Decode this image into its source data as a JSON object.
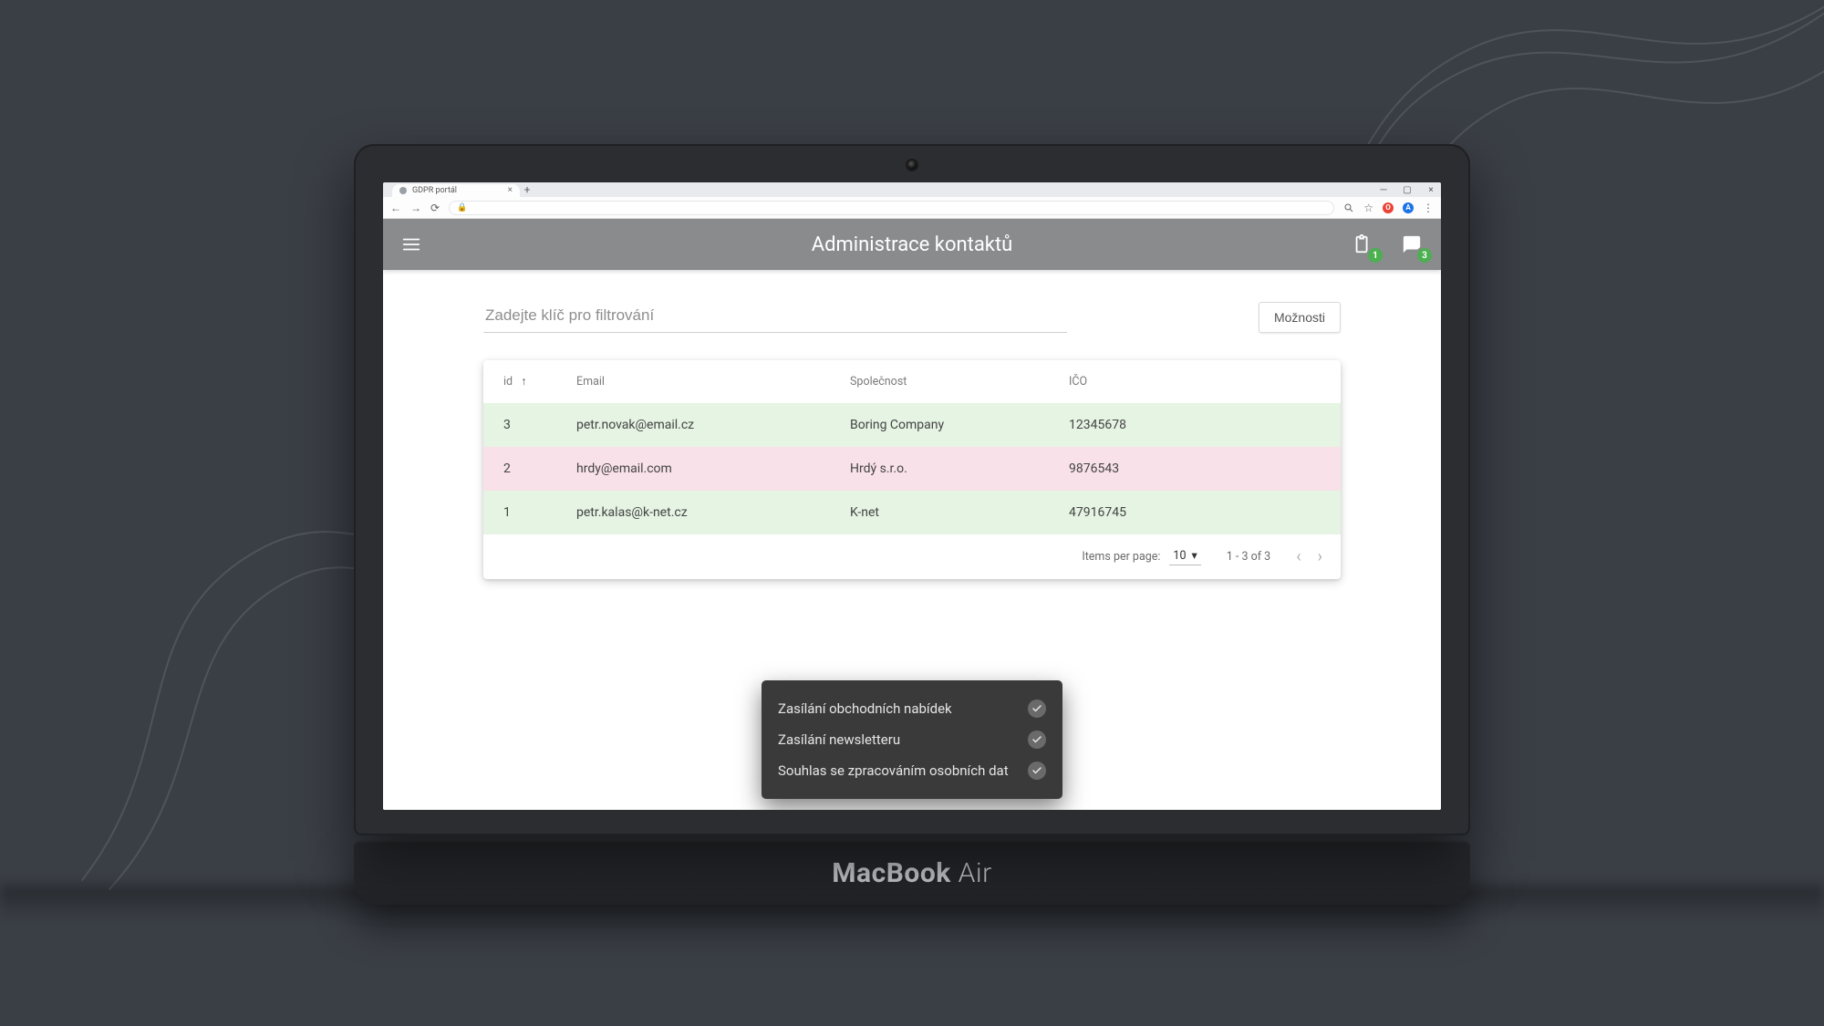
{
  "browser": {
    "tab_title": "GDPR portál",
    "ext_badge_1": "O",
    "ext_badge_2": "A"
  },
  "header": {
    "title": "Administrace kontaktů",
    "badge_clipboard": "1",
    "badge_chat": "3"
  },
  "filter": {
    "placeholder": "Zadejte klíč pro filtrování",
    "options_button": "Možnosti"
  },
  "table": {
    "columns": {
      "id": "id",
      "email": "Email",
      "company": "Společnost",
      "ico": "IČO"
    },
    "rows": [
      {
        "id": "3",
        "email": "petr.novak@email.cz",
        "company": "Boring Company",
        "ico": "12345678",
        "status": "green"
      },
      {
        "id": "2",
        "email": "hrdy@email.com",
        "company": "Hrdý s.r.o.",
        "ico": "9876543",
        "status": "pink"
      },
      {
        "id": "1",
        "email": "petr.kalas@k-net.cz",
        "company": "K-net",
        "ico": "47916745",
        "status": "green"
      }
    ]
  },
  "paginator": {
    "items_per_page_label": "Items per page:",
    "items_per_page_value": "10",
    "range_label": "1 - 3 of 3"
  },
  "popover": {
    "items": [
      "Zasílání obchodních nabídek",
      "Zasílání newsletteru",
      "Souhlas se zpracováním osobních dat"
    ]
  },
  "device": {
    "brand_bold": "MacBook",
    "brand_light": " Air"
  }
}
